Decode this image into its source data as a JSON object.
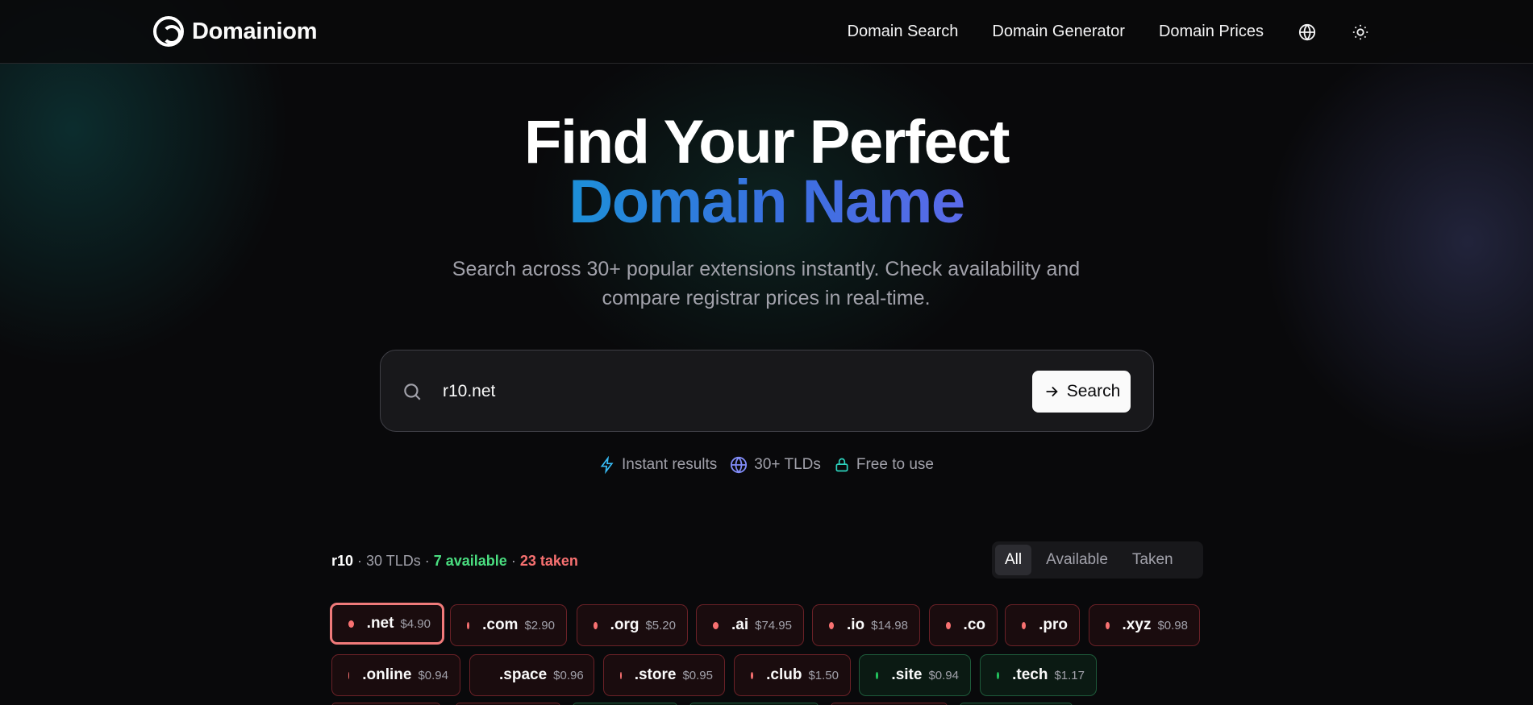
{
  "brand": {
    "name": "Domainiom"
  },
  "nav": {
    "items": [
      "Domain Search",
      "Domain Generator",
      "Domain Prices"
    ],
    "icons": [
      "globe-icon",
      "sun-icon"
    ]
  },
  "hero": {
    "title_line1": "Find Your Perfect",
    "title_line2": "Domain Name",
    "subtitle_line1": "Search across 30+ popular extensions instantly. Check availability and",
    "subtitle_line2": "compare registrar prices in real-time."
  },
  "search": {
    "value": "r10.net",
    "button_label": "Search"
  },
  "features": [
    {
      "icon": "lightning-icon",
      "label": "Instant results",
      "color": "#38bdf8"
    },
    {
      "icon": "globe-icon",
      "label": "30+ TLDs",
      "color": "#818cf8"
    },
    {
      "icon": "lock-icon",
      "label": "Free to use",
      "color": "#2dd4bf"
    }
  ],
  "results": {
    "query": "r10",
    "tld_count": "30 TLDs",
    "available": "7 available",
    "taken": "23 taken",
    "separator": " · ",
    "filters": [
      "All",
      "Available",
      "Taken"
    ],
    "active_filter": "All",
    "row1": [
      {
        "tld": ".net",
        "price": "$4.90",
        "status": "taken",
        "selected": true
      },
      {
        "tld": ".com",
        "price": "$2.90",
        "status": "taken"
      },
      {
        "tld": ".org",
        "price": "$5.20",
        "status": "taken"
      },
      {
        "tld": ".ai",
        "price": "$74.95",
        "status": "taken"
      },
      {
        "tld": ".io",
        "price": "$14.98",
        "status": "taken"
      },
      {
        "tld": ".co",
        "price": "",
        "status": "taken"
      },
      {
        "tld": ".pro",
        "price": "",
        "status": "taken"
      },
      {
        "tld": ".xyz",
        "price": "$0.98",
        "status": "taken"
      }
    ],
    "row2": [
      {
        "tld": ".online",
        "price": "$0.94",
        "status": "taken"
      },
      {
        "tld": ".space",
        "price": "$0.96",
        "status": "taken"
      },
      {
        "tld": ".store",
        "price": "$0.95",
        "status": "taken"
      },
      {
        "tld": ".club",
        "price": "$1.50",
        "status": "taken"
      },
      {
        "tld": ".site",
        "price": "$0.94",
        "status": "available"
      },
      {
        "tld": ".tech",
        "price": "$1.17",
        "status": "available"
      }
    ]
  },
  "colors": {
    "accent_blue": "#1d8fd8",
    "accent_indigo": "#5a6ae8",
    "available": "#4ade80",
    "taken": "#f87171"
  }
}
